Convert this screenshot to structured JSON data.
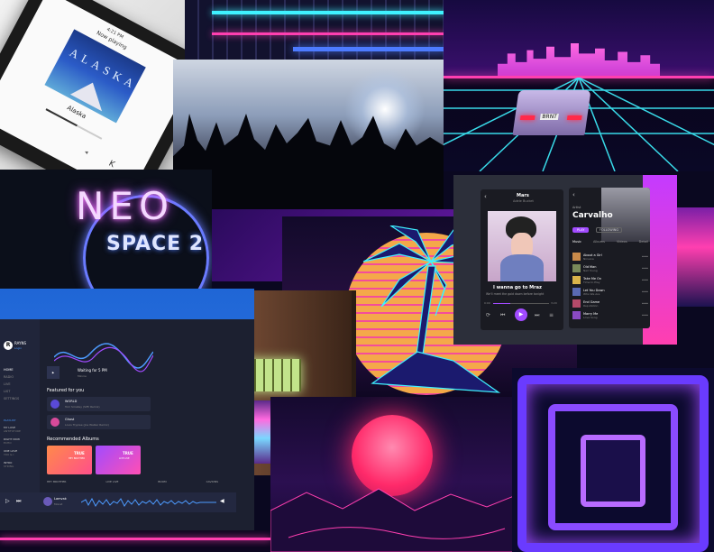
{
  "phone": {
    "status_time": "4:21 PM",
    "now_playing": "Now playing",
    "album_art_text": "ALASKA",
    "track_title": "Alaska",
    "control_label": "K"
  },
  "neon_logo": {
    "title": "NEO",
    "subtitle": "SPACE 2"
  },
  "music_app": {
    "player": {
      "track_name": "Mars",
      "track_sub": "Adele Bucket",
      "song_title": "I wanna go to Mraz",
      "song_sub": "We'll meet the gold dawn before tonight",
      "time_start": "0:00",
      "time_end": "3:20"
    },
    "artist": {
      "label": "Artist",
      "name": "Carvalho",
      "play_button": "PLAY",
      "follow_button": "FOLLOWING",
      "tabs": [
        "Music",
        "Albums",
        "Videos",
        "Detail"
      ],
      "songs": [
        {
          "title": "About a Girl",
          "sub": "Nirvana"
        },
        {
          "title": "Old Man",
          "sub": "Neil Young"
        },
        {
          "title": "Take Me On",
          "sub": "Time to Play"
        },
        {
          "title": "Let You Down",
          "sub": "Who We Are"
        },
        {
          "title": "End Game",
          "sub": "Reputation"
        },
        {
          "title": "Marry Me",
          "sub": "Love Song"
        }
      ]
    }
  },
  "dashboard": {
    "brand_letter": "R",
    "brand_name": "RAYNS",
    "brand_sub": "Login",
    "nav": [
      "HOME",
      "RADIO",
      "LIVE",
      "LIST",
      "SETTINGS"
    ],
    "playlist_header": "PLAYLIST",
    "playlists": [
      {
        "title": "MY LOVE",
        "sub": "ANTIFUTURE"
      },
      {
        "title": "RIGHT NOW",
        "sub": "ECHO"
      },
      {
        "title": "ONE LOVE",
        "sub": "YOU & I"
      },
      {
        "title": "INTRO",
        "sub": "STRING"
      }
    ],
    "waiting_title": "Waiting for 5 PM",
    "waiting_sub": "Minnie",
    "featured_title": "Featured for you",
    "featured": [
      {
        "title": "WORLD",
        "sub": "Tom Smalley (Siffr Remix)"
      },
      {
        "title": "Ghost",
        "sub": "Louis Tryplee (Joe Walker Remix)"
      }
    ],
    "recommended_title": "Recommended Albums",
    "albums": [
      {
        "title": "TRUE",
        "sub": "HEY BROTHER"
      },
      {
        "title": "TRUE",
        "sub": "LIVE LIVE"
      }
    ],
    "album_row": [
      "HEY BROTHER",
      "LIVE LIVE",
      "BOOM",
      "CAVIONS"
    ],
    "now_playing_title": "Lamvak",
    "now_playing_sub": "Monet"
  },
  "car": {
    "plate": "BRNT"
  },
  "colors": {
    "neon_pink": "#ff3fb0",
    "neon_cyan": "#3ff2ff",
    "neon_purple": "#8a3bff",
    "accent_blue": "#1f66d6"
  }
}
